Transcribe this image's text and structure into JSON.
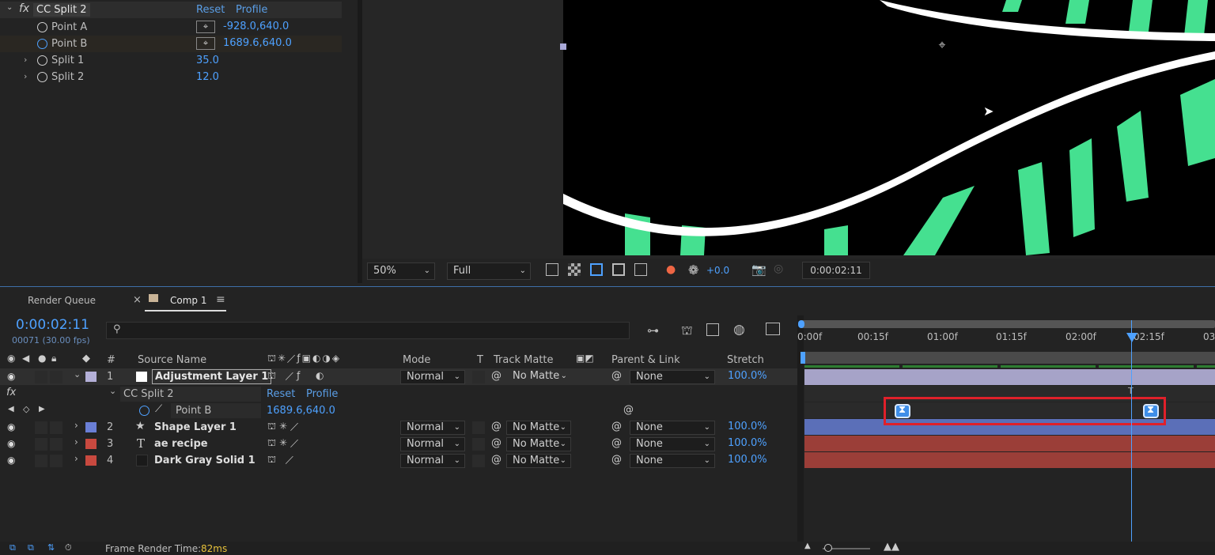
{
  "effect_controls": {
    "effect_name": "CC Split 2",
    "reset": "Reset",
    "profile": "Profile",
    "props": [
      {
        "label": "Point A",
        "value": "-928.0,640.0"
      },
      {
        "label": "Point B",
        "value": "1689.6,640.0"
      },
      {
        "label": "Split 1",
        "value": "35.0"
      },
      {
        "label": "Split 2",
        "value": "12.0"
      }
    ],
    "fx_label": "fx"
  },
  "viewer": {
    "zoom": "50%",
    "resolution": "Full",
    "exposure": "+0.0",
    "timecode": "0:00:02:11"
  },
  "panel_tabs": {
    "render_queue": "Render Queue",
    "comp": "Comp 1",
    "close": "×",
    "menu": "≡"
  },
  "timeline": {
    "current_time": "0:00:02:11",
    "frame_info": "00071 (30.00 fps)",
    "search_placeholder": "",
    "headers": {
      "hash": "#",
      "source": "Source Name",
      "mode": "Mode",
      "t": "T",
      "track_matte": "Track Matte",
      "parent": "Parent & Link",
      "stretch": "Stretch"
    },
    "ruler": [
      "0:00f",
      "00:15f",
      "01:00f",
      "01:15f",
      "02:00f",
      "02:15f",
      "03"
    ],
    "layers": [
      {
        "num": "1",
        "name": "Adjustment Layer 1",
        "mode": "Normal",
        "matte": "No Matte",
        "parent": "None",
        "stretch": "100.0%",
        "label_color": "#b4b0d8"
      },
      {
        "num": "2",
        "name": "Shape Layer 1",
        "mode": "Normal",
        "matte": "No Matte",
        "parent": "None",
        "stretch": "100.0%",
        "label_color": "#6a7fd6"
      },
      {
        "num": "3",
        "name": "ae recipe",
        "mode": "Normal",
        "matte": "No Matte",
        "parent": "None",
        "stretch": "100.0%",
        "label_color": "#c8493f"
      },
      {
        "num": "4",
        "name": "Dark Gray Solid 1",
        "mode": "Normal",
        "matte": "No Matte",
        "parent": "None",
        "stretch": "100.0%",
        "label_color": "#c8493f"
      }
    ],
    "effect_row": {
      "name": "CC Split 2",
      "reset": "Reset",
      "profile": "Profile"
    },
    "property_row": {
      "label": "Point B",
      "value": "1689.6,640.0"
    },
    "footer": {
      "label": "Frame Render Time:",
      "value": "82ms"
    }
  },
  "colors": {
    "accent": "#4ea1ff",
    "highlight_box": "#e0202a",
    "text_green": "#45e090"
  }
}
